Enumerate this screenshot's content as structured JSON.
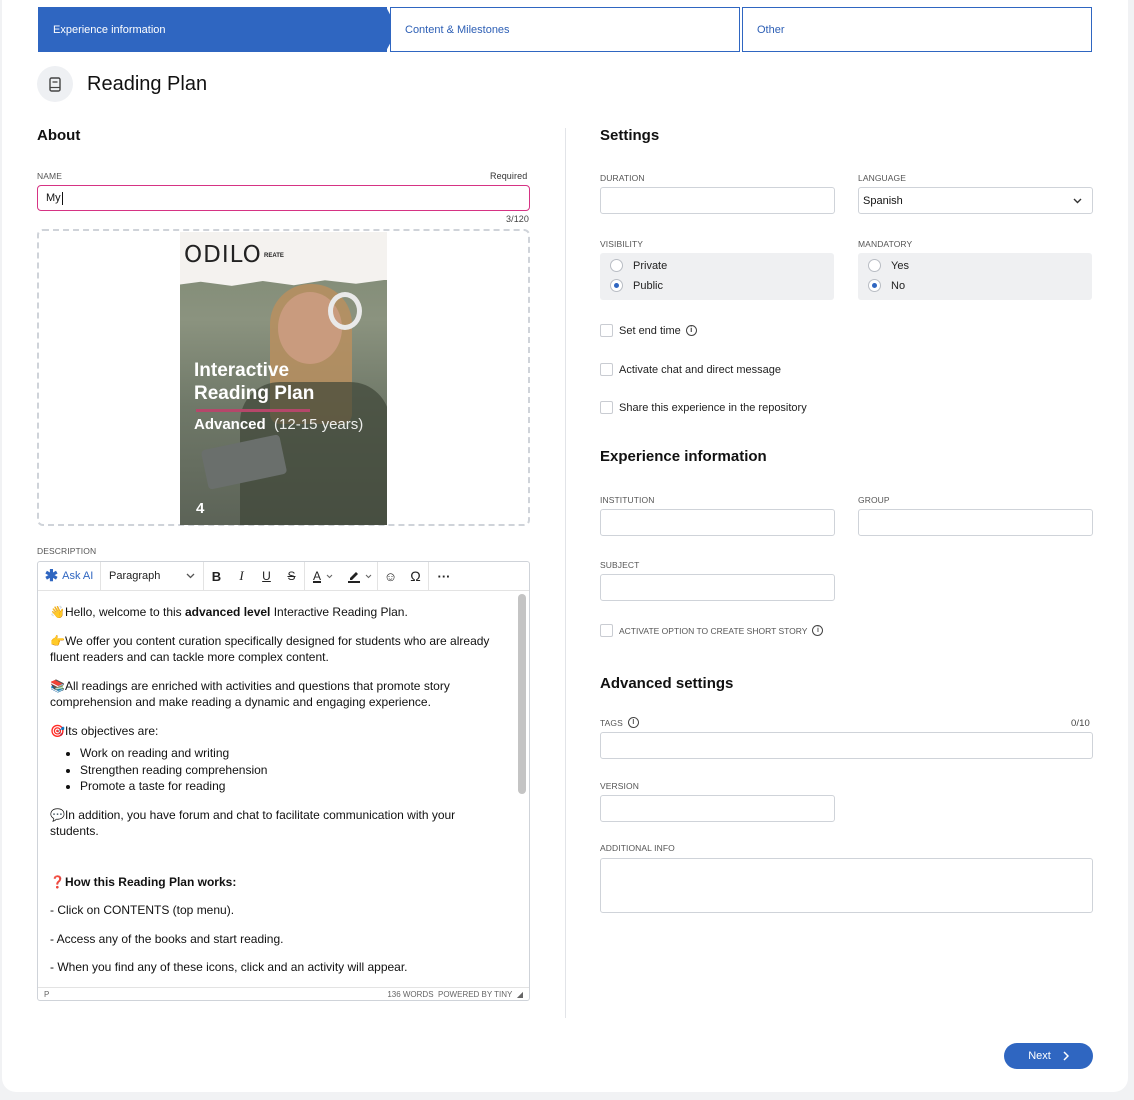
{
  "steps": [
    {
      "label": "Experience information"
    },
    {
      "label": "Content & Milestones"
    },
    {
      "label": "Other"
    }
  ],
  "page": {
    "title": "Reading Plan"
  },
  "about": {
    "heading": "About",
    "name_label": "NAME",
    "required": "Required",
    "name_value": "My",
    "char_count": "3/120",
    "description_label": "DESCRIPTION"
  },
  "cover": {
    "logo": "ODILO",
    "logo_sub": "REATE",
    "title": "Interactive\nReading Plan",
    "level": "Advanced",
    "age": "(12-15 years)",
    "number": "4"
  },
  "editor": {
    "ask_ai": "Ask AI",
    "block_format": "Paragraph",
    "p1_pre": "Hello, welcome to this ",
    "p1_bold": "advanced level",
    "p1_post": " Interactive Reading Plan.",
    "p2": "We offer you content curation specifically designed for students who are already fluent readers and can tackle more complex content.",
    "p3": "All readings are enriched with activities and questions that promote story comprehension and make reading a dynamic and engaging experience.",
    "p4": "Its objectives are:",
    "objectives": [
      "Work on reading and writing",
      "Strengthen reading comprehension",
      "Promote a taste for reading"
    ],
    "p5": "In addition, you have forum and chat to facilitate communication with your students.",
    "h_works": "How this Reading Plan works:",
    "step1": "- Click on CONTENTS (top menu).",
    "step2": "- Access any of the books and start reading.",
    "step3": "- When you find any of these icons, click and an activity will appear.",
    "status_path": "P",
    "word_count": "136 WORDS",
    "powered": "POWERED BY TINY"
  },
  "settings": {
    "heading": "Settings",
    "duration_label": "DURATION",
    "language_label": "LANGUAGE",
    "language_value": "Spanish",
    "visibility_label": "VISIBILITY",
    "visibility_options": [
      "Private",
      "Public"
    ],
    "visibility_selected": "Public",
    "mandatory_label": "MANDATORY",
    "mandatory_options": [
      "Yes",
      "No"
    ],
    "mandatory_selected": "No",
    "set_end_time": "Set end time",
    "activate_chat": "Activate chat and direct message",
    "share_repo": "Share this experience in the repository"
  },
  "experience": {
    "heading": "Experience information",
    "institution_label": "INSTITUTION",
    "group_label": "GROUP",
    "subject_label": "SUBJECT",
    "short_story": "ACTIVATE OPTION TO CREATE SHORT STORY"
  },
  "advanced": {
    "heading": "Advanced settings",
    "tags_label": "TAGS",
    "tags_count": "0/10",
    "version_label": "VERSION",
    "additional_label": "ADDITIONAL INFO"
  },
  "footer": {
    "next": "Next"
  },
  "colors": {
    "primary": "#2f66c1",
    "focus_border": "#d63384",
    "cover_accent": "#b5476a"
  }
}
